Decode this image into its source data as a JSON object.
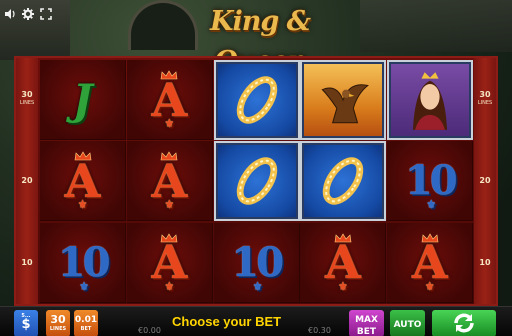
{
  "game": {
    "title": "King & Queen"
  },
  "top_controls": {
    "sound_icon": "speaker-icon",
    "settings_icon": "gear-icon",
    "fullscreen_icon": "fullscreen-icon"
  },
  "paylines": {
    "left": [
      {
        "number": "30",
        "caption": "LINES"
      },
      {
        "number": "20",
        "caption": ""
      },
      {
        "number": "10",
        "caption": ""
      }
    ],
    "right": [
      {
        "number": "30",
        "caption": "LINES"
      },
      {
        "number": "20",
        "caption": ""
      },
      {
        "number": "10",
        "caption": ""
      }
    ]
  },
  "reels": {
    "rows": [
      [
        "J",
        "A",
        "ring",
        "eagle",
        "queen"
      ],
      [
        "A",
        "A",
        "ring",
        "ring",
        "10"
      ],
      [
        "10",
        "A",
        "10",
        "A",
        "A"
      ]
    ],
    "winning_cells": [
      [
        0,
        2
      ],
      [
        0,
        3
      ],
      [
        0,
        4
      ],
      [
        1,
        2
      ],
      [
        1,
        3
      ]
    ]
  },
  "bottom_bar": {
    "balance_label": "5...",
    "currency_symbol": "$",
    "lines_value": "30",
    "lines_label": "LINES",
    "bet_value": "0.01",
    "bet_label": "BET",
    "message": "Choose your BET",
    "credit_ghost_left": "€0.00",
    "credit_ghost_right": "€0.30",
    "max_bet_label_1": "MAX",
    "max_bet_label_2": "BET",
    "auto_label": "AUTO",
    "spin_icon": "spin-arrows-icon"
  },
  "colors": {
    "frame_red": "#6c0e0b",
    "win_blue": "#1d57b5",
    "title_gold": "#e9b94e",
    "message_yellow": "#ffd400",
    "auto_green": "#1e9c2a",
    "maxbet_purple": "#b02bb0",
    "lines_orange": "#e26a14",
    "balance_blue": "#1f63c9"
  }
}
